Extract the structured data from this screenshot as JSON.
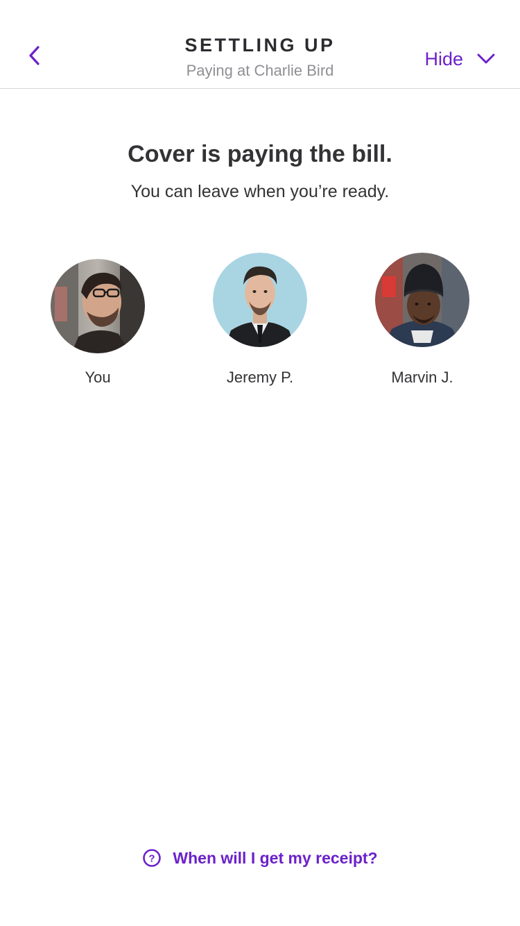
{
  "header": {
    "title": "SETTLING UP",
    "subtitle": "Paying at Charlie Bird",
    "hide_label": "Hide"
  },
  "message": {
    "headline": "Cover is paying the bill.",
    "subline": "You can leave when you’re ready."
  },
  "people": [
    {
      "name": "You"
    },
    {
      "name": "Jeremy P."
    },
    {
      "name": "Marvin J."
    }
  ],
  "footer": {
    "help_link": "When will I get my receipt?"
  },
  "colors": {
    "accent": "#6b21c9",
    "text": "#333336",
    "muted": "#8f8f94",
    "divider": "#d6d6d8"
  },
  "icons": {
    "back": "chevron-left-icon",
    "hide": "chevron-down-icon",
    "help": "question-circle-icon"
  }
}
